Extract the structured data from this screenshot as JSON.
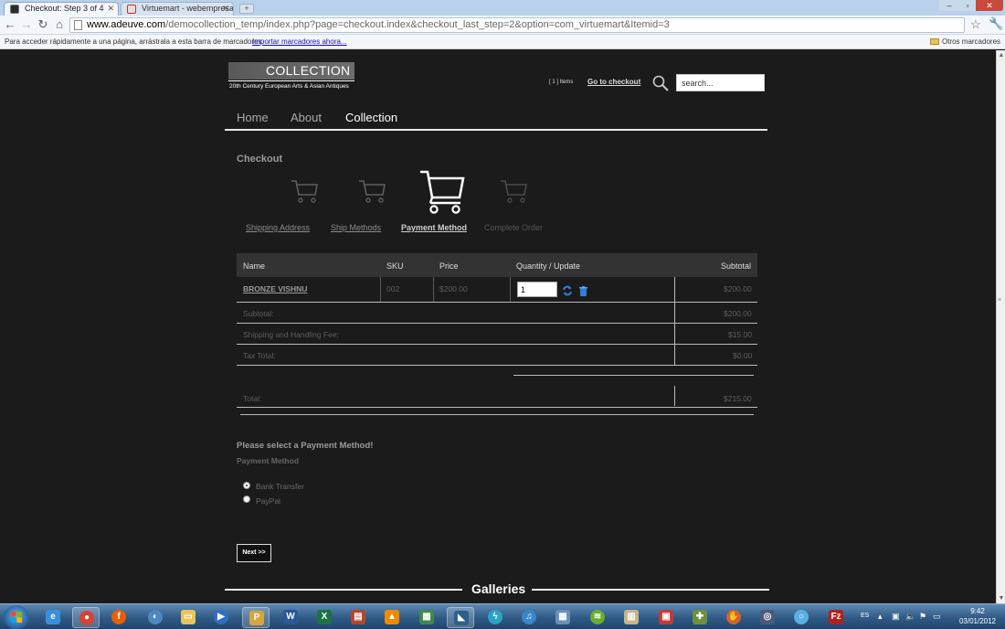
{
  "browser": {
    "tabs": [
      {
        "title": "Checkout: Step 3 of 4",
        "active": true
      },
      {
        "title": "Virtuemart - webempresa.jc",
        "active": false
      }
    ],
    "url_host": "www.adeuve.com",
    "url_rest": "/democollection_temp/index.php?page=checkout.index&checkout_last_step=2&option=com_virtuemart&Itemid=3",
    "bookmarks_hint": "Para acceder rápidamente a una página, arrástrala a esta barra de marcadores.",
    "bookmarks_import": "Importar marcadores ahora...",
    "bookmarks_other": "Otros marcadores"
  },
  "site": {
    "logo_title": "COLLECTION",
    "logo_subtitle": "20th Century European Arts & Asian Antiques",
    "cart_count": "[ 1 ] Items",
    "checkout_link": "Go to checkout",
    "search_value": "search...",
    "nav": [
      "Home",
      "About",
      "Collection"
    ],
    "galleries_heading": "Galleries"
  },
  "checkout": {
    "title": "Checkout",
    "steps": [
      {
        "label": "Shipping Address",
        "state": "done"
      },
      {
        "label": "Ship Methods",
        "state": "done"
      },
      {
        "label": "Payment Method",
        "state": "current"
      },
      {
        "label": "Complete Order",
        "state": "pending"
      }
    ]
  },
  "cart": {
    "headers": {
      "name": "Name",
      "sku": "SKU",
      "price": "Price",
      "qty": "Quantity / Update",
      "subtotal": "Subtotal"
    },
    "item": {
      "name": "BRONZE VISHNU",
      "sku": "002",
      "price": "$200.00",
      "quantity": "1",
      "subtotal": "$200.00"
    },
    "subtotal_label": "Subtotal:",
    "subtotal_value": "$200.00",
    "shipping_label": "Shipping and Handling Fee:",
    "shipping_value": "$15.00",
    "tax_label": "Tax Total:",
    "tax_value": "$0.00",
    "total_label": "Total:",
    "total_value": "$215.00"
  },
  "payment": {
    "prompt": "Please select a Payment Method!",
    "subheading": "Payment Method",
    "options": [
      {
        "label": "Bank Transfer",
        "selected": true
      },
      {
        "label": "PayPal",
        "selected": false
      }
    ],
    "next_label": "Next >>"
  },
  "taskbar": {
    "language": "ES",
    "time": "9:42",
    "date": "03/01/2012",
    "apps": [
      "internet-explorer",
      "chrome",
      "firefox",
      "program-1",
      "explorer",
      "media-player",
      "program-2",
      "word",
      "excel",
      "program-3",
      "vlc",
      "program-4",
      "program-5",
      "program-6",
      "itunes",
      "calculator",
      "spotify",
      "program-7",
      "program-8",
      "program-9",
      "program-10",
      "program-11",
      "filezilla"
    ],
    "active_apps": [
      "chrome",
      "program-2",
      "program-5"
    ]
  },
  "colors": {
    "page_bg": "#1b1b1b",
    "accent_blue": "#2f7ed8",
    "close_red": "#c74a3c"
  }
}
